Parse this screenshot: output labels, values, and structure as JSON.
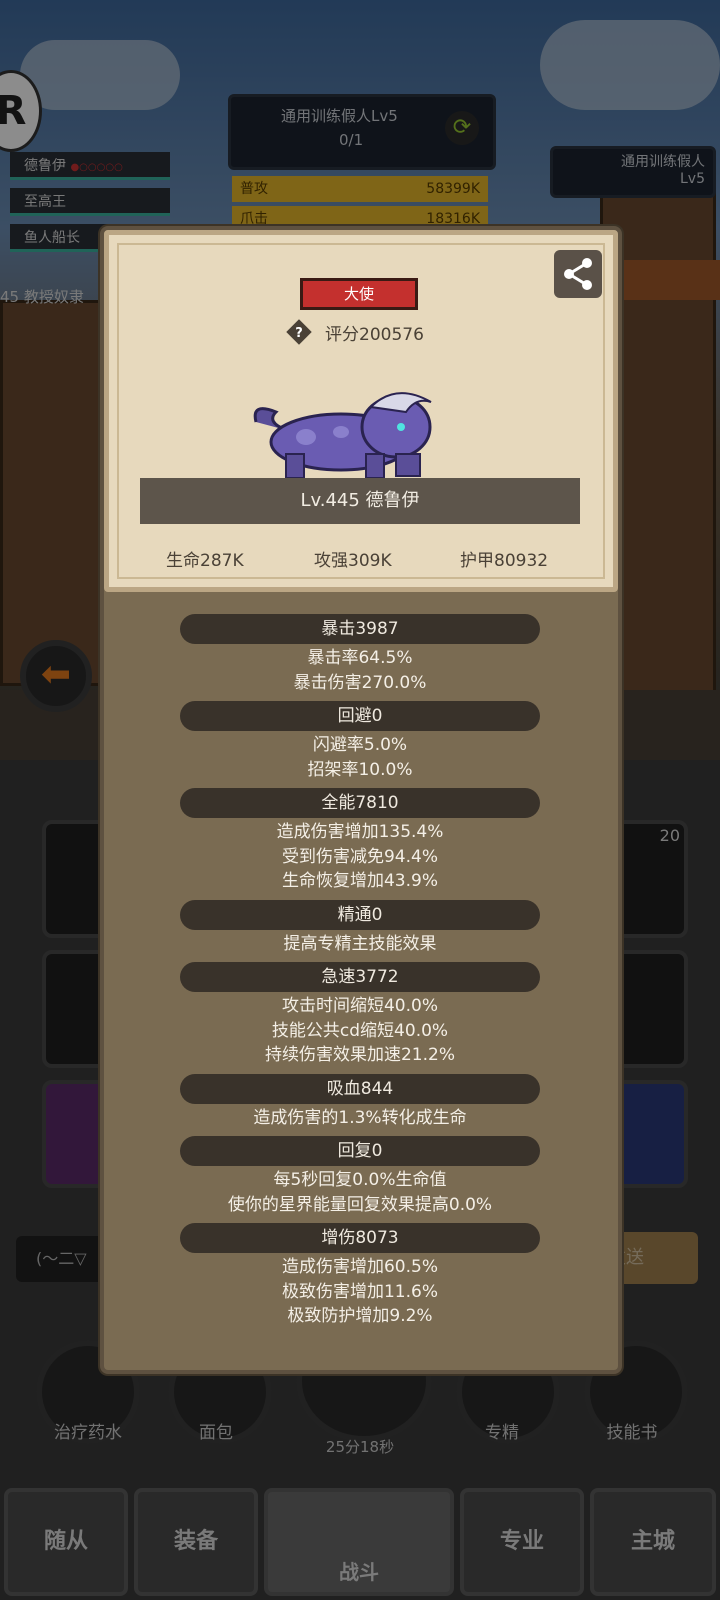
{
  "background": {
    "target_name": "通用训练假人Lv5",
    "target_progress": "0/1",
    "enemy_tag_line1": "通用训练假人",
    "enemy_tag_line2": "Lv5",
    "team": [
      "德鲁伊",
      "至高王",
      "鱼人船长"
    ],
    "level_hint": "45 教授奴隶",
    "damage_rows": [
      {
        "name": "普攻",
        "value": "58399K"
      },
      {
        "name": "爪击",
        "value": "18316K"
      }
    ],
    "slot_count_badge": "20",
    "send_label": "发送",
    "chat_select": "(～二▽",
    "items": [
      "治疗药水",
      "面包",
      "专精",
      "技能书"
    ],
    "timer": "25分18秒",
    "nav": [
      "随从",
      "装备",
      "战斗",
      "专业",
      "主城"
    ]
  },
  "card": {
    "rank": "大使",
    "score": "评分200576",
    "name": "Lv.445 德鲁伊",
    "hp": "生命287K",
    "atk": "攻强309K",
    "armor": "护甲80932"
  },
  "sections": [
    {
      "title": "暴击3987",
      "lines": [
        "暴击率64.5%",
        "暴击伤害270.0%"
      ]
    },
    {
      "title": "回避0",
      "lines": [
        "闪避率5.0%",
        "招架率10.0%"
      ]
    },
    {
      "title": "全能7810",
      "lines": [
        "造成伤害增加135.4%",
        "受到伤害减免94.4%",
        "生命恢复增加43.9%"
      ]
    },
    {
      "title": "精通0",
      "lines": [
        "提高专精主技能效果"
      ]
    },
    {
      "title": "急速3772",
      "lines": [
        "攻击时间缩短40.0%",
        "技能公共cd缩短40.0%",
        "持续伤害效果加速21.2%"
      ]
    },
    {
      "title": "吸血844",
      "lines": [
        "造成伤害的1.3%转化成生命"
      ]
    },
    {
      "title": "回复0",
      "lines": [
        "每5秒回复0.0%生命值",
        "使你的星界能量回复效果提高0.0%"
      ]
    },
    {
      "title": "增伤8073",
      "lines": [
        "造成伤害增加60.5%",
        "极致伤害增加11.6%",
        "极致防护增加9.2%"
      ]
    }
  ],
  "colors": {
    "rank_red": "#c4302e",
    "modal_brown": "#7a6b52",
    "card_parchment": "#e7d9bd",
    "header_pill": "#39322a"
  }
}
